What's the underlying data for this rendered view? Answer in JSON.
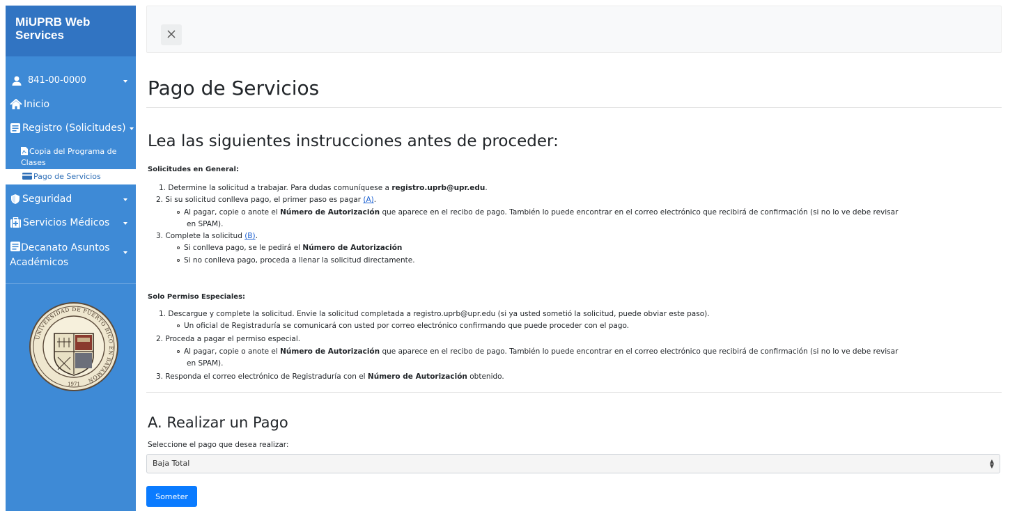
{
  "sidebar": {
    "brand": "MiUPRB Web Services",
    "user": {
      "label": "841-00-0000",
      "icon": "user-icon"
    },
    "items": [
      {
        "label": "Inicio",
        "icon": "home-icon"
      },
      {
        "label": "Registro (Solicitudes)",
        "icon": "book-icon"
      },
      {
        "label": "Copia del Programa de Clases",
        "icon": "pdf-icon"
      },
      {
        "label": "Pago de Servicios",
        "icon": "credit-card-icon"
      },
      {
        "label": "Seguridad",
        "icon": "shield-icon"
      },
      {
        "label": "Servicios Médicos",
        "icon": "medical-icon"
      },
      {
        "label": "Decanato Asuntos Académicos",
        "icon": "book-icon"
      }
    ],
    "seal": {
      "text": "UNIVERSIDAD DE PUERTO RICO EN BAYAMÓN",
      "year": "1971"
    },
    "colors": {
      "background": "#3e8ad6",
      "brand_bg": "#3174c2",
      "active_text": "#2f6fb7"
    }
  },
  "topbar": {
    "close_icon": "close-icon"
  },
  "page": {
    "title": "Pago de Servicios",
    "instructions_heading": "Lea las siguientes instrucciones antes de proceder:",
    "general": {
      "title": "Solicitudes en General:",
      "l1_num": "1.",
      "l1_text": "Determine la solicitud a trabajar. Para dudas comuníquese a ",
      "l1_email": "registro.uprb@upr.edu",
      "l1_end": ".",
      "l2_num": "2.",
      "l2_text": "Si su solicitud conlleva pago, el primer paso es pagar ",
      "l2_link": "(A)",
      "l2_end": ".",
      "l2a_pre": "Al pagar, copie o anote el ",
      "l2a_bold": "Número de Autorización",
      "l2a_post": " que aparece en el recibo de pago. También lo puede encontrar en el correo electrónico que recibirá de confirmación (si no lo ve debe revisar",
      "l2a_cont": "en SPAM).",
      "l3_num": "3.",
      "l3_text": "Complete la solicitud ",
      "l3_link": "(B)",
      "l3_end": ".",
      "l3a_pre": "Si conlleva pago, se le pedirá el ",
      "l3a_bold": "Número de Autorización",
      "l3b": "Si no conlleva pago, proceda a llenar la solicitud directamente."
    },
    "especiales": {
      "title": "Solo Permiso Especiales:",
      "l1_num": "1.",
      "l1_text": "Descargue y complete la solicitud. Envie la solicitud completada a registro.uprb@upr.edu (si ya usted sometió la solicitud, puede obviar este paso).",
      "l1a": "Un oficial de Registraduría se comunicará con usted por correo electrónico confirmando que puede proceder con el pago.",
      "l2_num": "2.",
      "l2_text": "Proceda a pagar el permiso especial.",
      "l2a_pre": "Al pagar, copie o anote el ",
      "l2a_bold": "Número de Autorización",
      "l2a_post": " que aparece en el recibo de pago. También lo puede encontrar en el correo electrónico que recibirá de confirmación (si no lo ve debe revisar",
      "l2a_cont": "en SPAM).",
      "l3_num": "3.",
      "l3_pre": "Responda el correo electrónico de Registraduría con el ",
      "l3_bold": "Número de Autorización",
      "l3_post": " obtenido."
    },
    "payment": {
      "heading": "A. Realizar un Pago",
      "select_label": "Seleccione el pago que desea realizar:",
      "selected": "Baja Total",
      "submit": "Someter",
      "submit_color": "#0a7bff"
    }
  }
}
